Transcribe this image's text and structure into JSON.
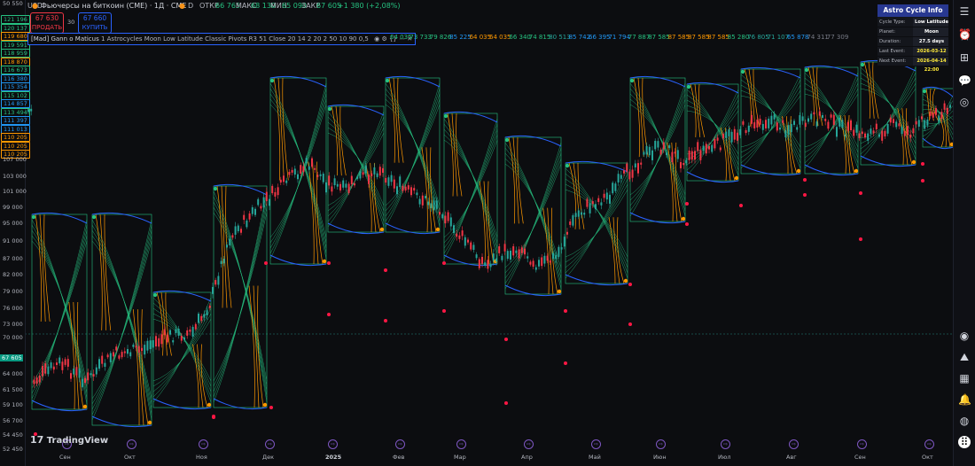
{
  "header": {
    "currency": "USD",
    "symbol_title": "Фьючерсы на биткоин (CME) · 1Д · CME",
    "source_badge": "D",
    "open_label": "ОТКР",
    "open_value": "66 765",
    "high_label": "МАКС",
    "high_value": "68 130",
    "low_label": "МИН",
    "low_value": "65 090",
    "close_label": "ЗАКР",
    "close_value": "67 605",
    "change": "+1 380 (+2,08%)"
  },
  "trade": {
    "sell_price": "67 630",
    "sell_label": "ПРОДАТЬ",
    "spread": "30",
    "buy_price": "67 660",
    "buy_label": "КУПИТЬ"
  },
  "indicator": {
    "name": "[Mad] Gann o Maticus",
    "params": "1 Astrocycles Moon Low Latitude Classic Pivots R3 51 Close 20 14 2 20 2 50 10 90 0,5",
    "values": [
      {
        "t": "64 035",
        "c": "#26c281"
      },
      {
        "t": "73 733",
        "c": "#26c281"
      },
      {
        "t": "79 826",
        "c": "#26c281"
      },
      {
        "t": "85 225",
        "c": "#2196f3"
      },
      {
        "t": "64 035",
        "c": "#ff9800"
      },
      {
        "t": "64 035",
        "c": "#ff9800"
      },
      {
        "t": "66 340",
        "c": "#26c281"
      },
      {
        "t": "74 815",
        "c": "#26c281"
      },
      {
        "t": "80 513",
        "c": "#26a69a"
      },
      {
        "t": "85 742",
        "c": "#2196f3"
      },
      {
        "t": "66 395",
        "c": "#2196f3"
      },
      {
        "t": "71 794",
        "c": "#2196f3"
      },
      {
        "t": "77 887",
        "c": "#26c281"
      },
      {
        "t": "87 585",
        "c": "#26c281"
      },
      {
        "t": "87 585",
        "c": "#ff9800"
      },
      {
        "t": "87 585",
        "c": "#ff9800"
      },
      {
        "t": "87 585",
        "c": "#ff9800"
      },
      {
        "t": "85 280",
        "c": "#26c281"
      },
      {
        "t": "76 805",
        "c": "#26a69a"
      },
      {
        "t": "71 107",
        "c": "#26a69a"
      },
      {
        "t": "65 878",
        "c": "#2196f3"
      },
      {
        "t": "74 311",
        "c": "#787b86"
      },
      {
        "t": "77 309",
        "c": "#787b86"
      }
    ]
  },
  "price_axis": {
    "ticks": [
      {
        "t": "121 196",
        "c": "#26c281",
        "box": true
      },
      {
        "t": "120 137",
        "c": "#26c281",
        "box": true
      },
      {
        "t": "119 680",
        "c": "#ff9800",
        "box": true
      },
      {
        "t": "119 591",
        "c": "#26c281",
        "box": true
      },
      {
        "t": "118 959",
        "c": "#26c281",
        "box": true
      },
      {
        "t": "118 870",
        "c": "#ff9800",
        "box": true
      },
      {
        "t": "116 673",
        "c": "#26c281",
        "box": true
      },
      {
        "t": "116 380",
        "c": "#2196f3",
        "box": true
      },
      {
        "t": "115 354",
        "c": "#2196f3",
        "box": true
      },
      {
        "t": "115 102",
        "c": "#26c281",
        "box": true
      },
      {
        "t": "114 857",
        "c": "#2196f3",
        "box": true
      },
      {
        "t": "113 494",
        "c": "#26c281",
        "box": true
      },
      {
        "t": "111 397",
        "c": "#2196f3",
        "box": true
      },
      {
        "t": "111 013",
        "c": "#2196f3",
        "box": true
      },
      {
        "t": "110 205",
        "c": "#ff9800",
        "box": true
      },
      {
        "t": "110 205",
        "c": "#ff9800",
        "box": true
      },
      {
        "t": "110 205",
        "c": "#ff9800",
        "box": true
      },
      {
        "t": "107 000",
        "c": "#b2b5be"
      },
      {
        "t": "103 000",
        "c": "#b2b5be"
      },
      {
        "t": "101 000",
        "c": "#b2b5be"
      },
      {
        "t": "99 000",
        "c": "#b2b5be"
      },
      {
        "t": "95 000",
        "c": "#b2b5be"
      },
      {
        "t": "91 000",
        "c": "#b2b5be"
      },
      {
        "t": "87 000",
        "c": "#b2b5be"
      },
      {
        "t": "82 000",
        "c": "#b2b5be"
      },
      {
        "t": "79 000",
        "c": "#b2b5be"
      },
      {
        "t": "76 000",
        "c": "#b2b5be"
      },
      {
        "t": "73 000",
        "c": "#b2b5be"
      },
      {
        "t": "70 000",
        "c": "#b2b5be"
      },
      {
        "t": "67 605",
        "c": "#ffffff",
        "current": true
      },
      {
        "t": "64 000",
        "c": "#b2b5be"
      },
      {
        "t": "61 500",
        "c": "#b2b5be"
      },
      {
        "t": "59 100",
        "c": "#b2b5be"
      },
      {
        "t": "56 700",
        "c": "#b2b5be"
      },
      {
        "t": "54 450",
        "c": "#b2b5be"
      },
      {
        "t": "52 450",
        "c": "#b2b5be"
      },
      {
        "t": "50 550",
        "c": "#b2b5be"
      }
    ]
  },
  "time_axis": {
    "months": [
      "Сен",
      "Окт",
      "Ноя",
      "Дек",
      "2025",
      "Фев",
      "Мар",
      "Апр",
      "Май",
      "Июн",
      "Июл",
      "Авг",
      "Сен",
      "Окт"
    ]
  },
  "astro_table": {
    "title": "Astro Cycle Info",
    "rows": [
      {
        "k": "Cycle Type:",
        "v": "Low Latitude"
      },
      {
        "k": "Planet:",
        "v": "Moon"
      },
      {
        "k": "Duration:",
        "v": "27.5 days"
      },
      {
        "k": "Last Event:",
        "v": "2026-03-12 22:00"
      },
      {
        "k": "Next Event:",
        "v": "2026-04-14 22:00"
      }
    ]
  },
  "branding": {
    "logo_text": "TradingView"
  },
  "colors": {
    "up": "#26a69a",
    "down": "#f23645",
    "cycle_green": "#26c281",
    "cycle_orange": "#ff9800",
    "cycle_blue": "#2962ff",
    "marker_red": "#ff1744"
  }
}
